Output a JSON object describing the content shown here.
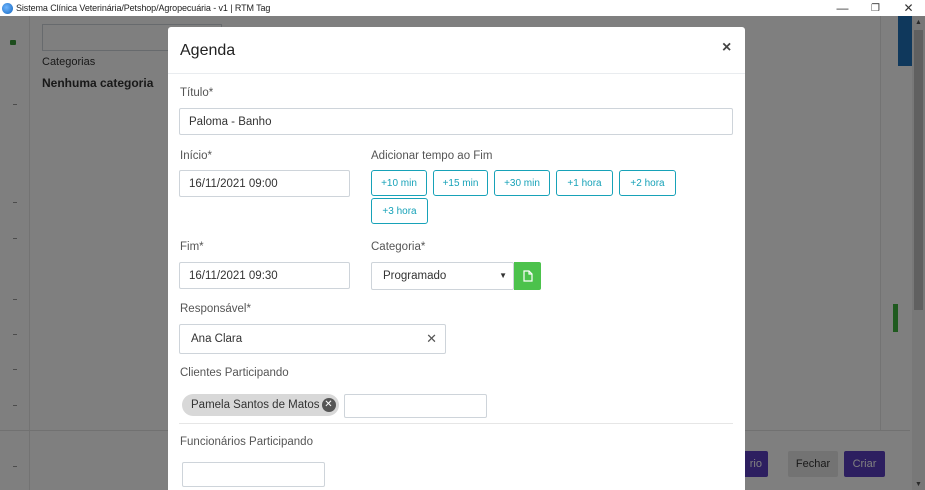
{
  "window": {
    "title": "Sistema Clínica Veterinária/Petshop/Agropecuária - v1 | RTM Tag",
    "minimize": "—",
    "restore": "❐",
    "close": "✕"
  },
  "background": {
    "categories_label": "Categorias",
    "categories_empty": "Nenhuma categoria",
    "relatorio_label": "rio",
    "fechar_label": "Fechar",
    "criar_label": "Criar"
  },
  "modal": {
    "title": "Agenda",
    "close": "×",
    "titulo": {
      "label": "Título*",
      "value": "Paloma - Banho"
    },
    "inicio": {
      "label": "Início*",
      "value": "16/11/2021 09:00"
    },
    "adicionar": {
      "label": "Adicionar tempo ao Fim",
      "buttons": [
        "+10 min",
        "+15 min",
        "+30 min",
        "+1 hora",
        "+2 hora",
        "+3 hora"
      ]
    },
    "fim": {
      "label": "Fim*",
      "value": "16/11/2021 09:30"
    },
    "categoria": {
      "label": "Categoria*",
      "value": "Programado"
    },
    "responsavel": {
      "label": "Responsável*",
      "value": "Ana Clara",
      "clear": "✕"
    },
    "clientes": {
      "label": "Clientes Participando",
      "chips": [
        "Pamela Santos de Matos"
      ]
    },
    "funcionarios": {
      "label": "Funcionários Participando"
    }
  }
}
